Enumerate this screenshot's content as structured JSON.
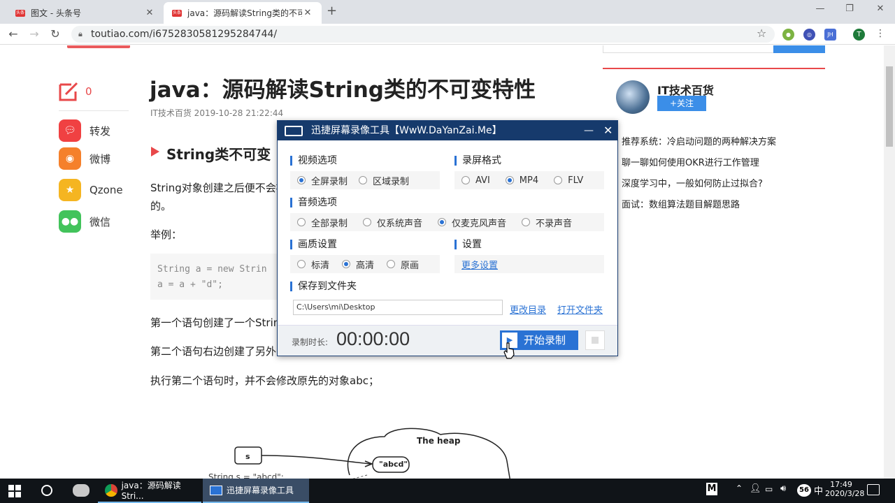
{
  "browser": {
    "tabs": [
      {
        "label": "图文 - 头条号",
        "favicon": "头条",
        "active": false
      },
      {
        "label": "java：源码解读String类的不可变",
        "favicon": "头条",
        "active": true
      }
    ],
    "url": "toutiao.com/i6752830581295284744/",
    "profile_initial": "T",
    "ext_jh": "JH"
  },
  "share": {
    "count": "0",
    "items": [
      {
        "label": "转发",
        "icon": "chat-bubble-icon",
        "color": "#f04142"
      },
      {
        "label": "微博",
        "icon": "weibo-icon",
        "color": "#f5802b"
      },
      {
        "label": "Qzone",
        "icon": "qzone-star-icon",
        "color": "#f5b521"
      },
      {
        "label": "微信",
        "icon": "wechat-icon",
        "color": "#42c35b"
      }
    ]
  },
  "article": {
    "title": "java：源码解读String类的不可变特性",
    "meta": "IT技术百货  2019-10-28 21:22:44",
    "h2": "String类不可变",
    "p1_line1": "String对象创建之后便不会被",
    "p1_line2": "的。",
    "example_label": "举例：",
    "code_line1": "String a = new Strin",
    "code_line2": "a = a + \"d\";",
    "p2": "第一个语句创建了一个Strin",
    "p3": "第二个语句右边创建了另外",
    "p4": "执行第二个语句时，并不会修改原先的对象abc；",
    "diagram": {
      "heap": "The heap",
      "var": "s",
      "value": "\"abcd\"",
      "caption": "String s = \"abcd\";"
    }
  },
  "sidebar": {
    "author": "IT技术百货",
    "follow_label": "+关注",
    "recommendations": [
      "推荐系统：冷启动问题的两种解决方案",
      "聊一聊如何使用OKR进行工作管理",
      "深度学习中，一般如何防止过拟合?",
      "面试：数组算法题目解题思路"
    ]
  },
  "recorder": {
    "title": "迅捷屏幕录像工具【WwW.DaYanZai.Me】",
    "video_label": "视频选项",
    "video_options": [
      {
        "label": "全屏录制",
        "selected": true
      },
      {
        "label": "区域录制",
        "selected": false
      }
    ],
    "format_label": "录屏格式",
    "format_options": [
      {
        "label": "AVI",
        "selected": false
      },
      {
        "label": "MP4",
        "selected": true
      },
      {
        "label": "FLV",
        "selected": false
      }
    ],
    "audio_label": "音频选项",
    "audio_options": [
      {
        "label": "全部录制",
        "selected": false
      },
      {
        "label": "仅系统声音",
        "selected": false
      },
      {
        "label": "仅麦克风声音",
        "selected": true
      },
      {
        "label": "不录声音",
        "selected": false
      }
    ],
    "quality_label": "画质设置",
    "quality_options": [
      {
        "label": "标清",
        "selected": false
      },
      {
        "label": "高清",
        "selected": true
      },
      {
        "label": "原画",
        "selected": false
      }
    ],
    "settings_label": "设置",
    "more_settings": "更多设置",
    "save_label": "保存到文件夹",
    "save_path": "C:\\Users\\mi\\Desktop",
    "change_dir": "更改目录",
    "open_folder": "打开文件夹",
    "duration_label": "录制时长:",
    "duration": "00:00:00",
    "start_button": "开始录制",
    "accent": "#2a72d4",
    "titlebar_color": "#163a6c"
  },
  "taskbar": {
    "apps": [
      {
        "label": "java：源码解读Stri...",
        "icon": "chrome-icon"
      },
      {
        "label": "迅捷屏幕录像工具",
        "icon": "recorder-icon"
      }
    ],
    "ime": "M",
    "badge": "56",
    "time": "17:49",
    "date": "2020/3/28",
    "ime_lang": "中"
  }
}
